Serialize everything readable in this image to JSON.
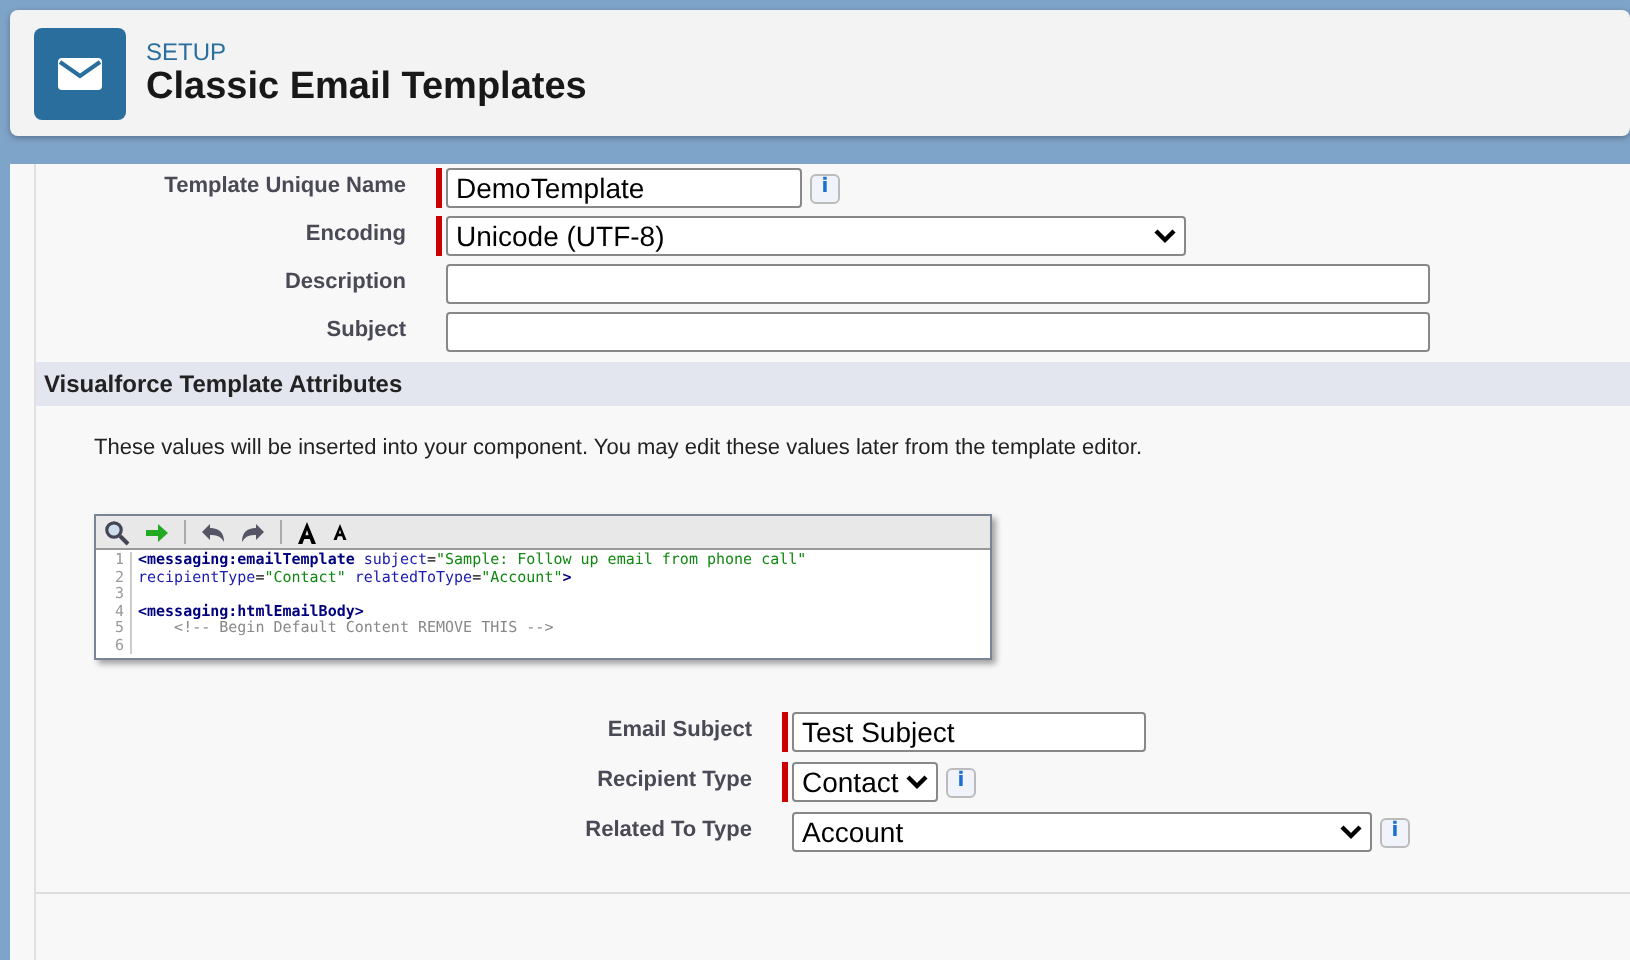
{
  "header": {
    "breadcrumb": "SETUP",
    "title": "Classic Email Templates"
  },
  "template_fields": [
    {
      "label": "Template Unique Name",
      "kind": "text",
      "value": "DemoTemplate",
      "required": true,
      "info": "i"
    },
    {
      "label": "Encoding",
      "kind": "select",
      "value": "Unicode (UTF-8)",
      "required": true
    },
    {
      "label": "Description",
      "kind": "text",
      "required": false
    },
    {
      "label": "Subject",
      "kind": "text",
      "required": false
    }
  ],
  "section": {
    "title": "Visualforce Template Attributes",
    "description": "These values will be inserted into your component. You may edit these values later from the template editor."
  },
  "code_editor": {
    "lines": [
      {
        "number": "1",
        "tokens": [
          {
            "kind": "tag",
            "text": "<messaging:emailTemplate "
          },
          {
            "kind": "attr",
            "text": "subject"
          },
          {
            "kind": "plain",
            "text": "="
          },
          {
            "kind": "string",
            "text": "\"Sample: Follow up email from phone call\""
          }
        ]
      },
      {
        "number": "2",
        "tokens": [
          {
            "kind": "attr",
            "text": "recipientType"
          },
          {
            "kind": "plain",
            "text": "="
          },
          {
            "kind": "string",
            "text": "\"Contact\" "
          },
          {
            "kind": "attr",
            "text": "relatedToType"
          },
          {
            "kind": "plain",
            "text": "="
          },
          {
            "kind": "string",
            "text": "\"Account\""
          },
          {
            "kind": "tag",
            "text": ">"
          }
        ]
      },
      {
        "number": "3"
      },
      {
        "number": "4",
        "tokens": [
          {
            "kind": "tag",
            "text": "<messaging:htmlEmailBody>"
          }
        ]
      },
      {
        "number": "5",
        "tokens": [
          {
            "kind": "comment",
            "text": "    <!-- Begin Default Content REMOVE THIS -->"
          }
        ]
      },
      {
        "number": "6"
      }
    ]
  },
  "attribute_fields": [
    {
      "label": "Email Subject",
      "kind": "text",
      "value": "Test Subject",
      "required": true
    },
    {
      "label": "Recipient Type",
      "kind": "select",
      "value": "Contact",
      "required": true,
      "info": "i"
    },
    {
      "label": "Related To Type",
      "kind": "select",
      "value": "Account",
      "required": false,
      "info": "i"
    }
  ]
}
